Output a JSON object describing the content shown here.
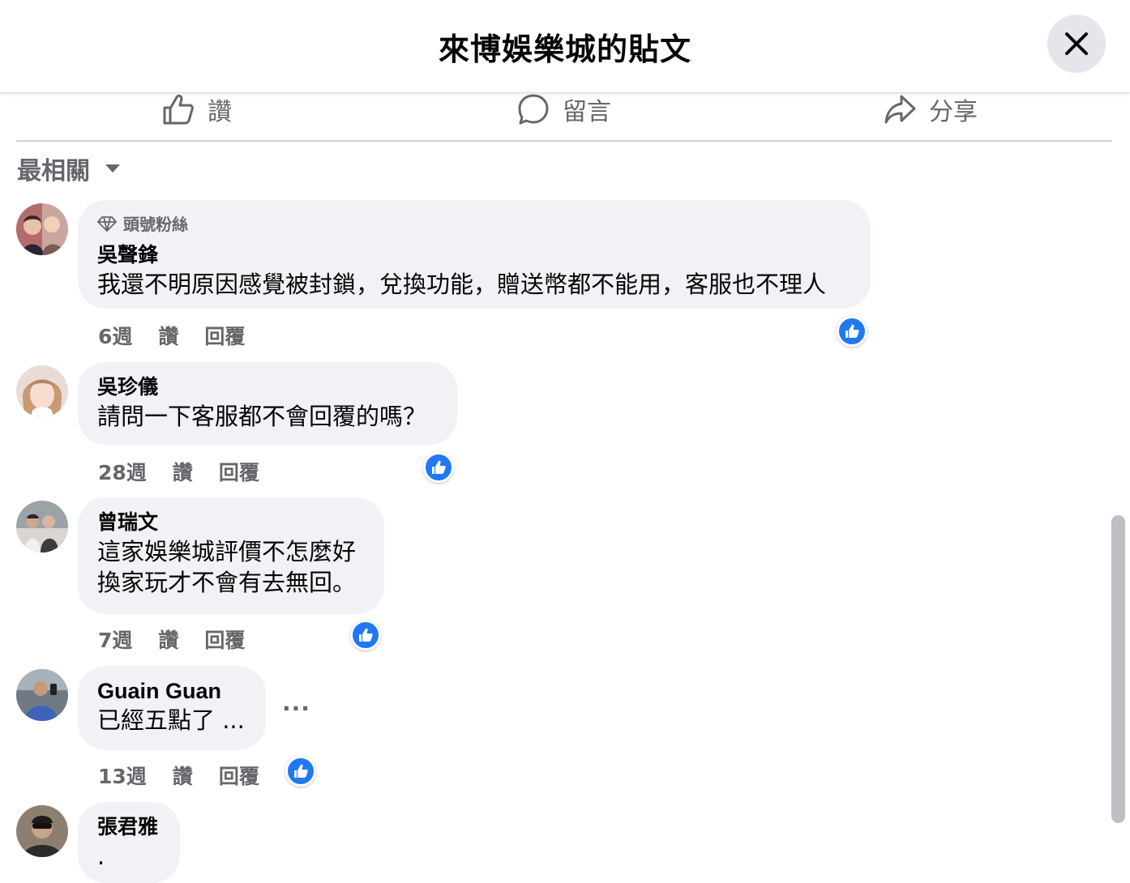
{
  "header": {
    "title": "來博娛樂城的貼文"
  },
  "actions": {
    "like": "讚",
    "comment": "留言",
    "share": "分享"
  },
  "sort": {
    "label": "最相關"
  },
  "comments": [
    {
      "badge": "頭號粉絲",
      "author": "吳聲鋒",
      "text": "我還不明原因感覺被封鎖，兌換功能，贈送幣都不能用，客服也不理人",
      "time": "6週",
      "like": "讚",
      "reply": "回覆"
    },
    {
      "author": "吳珍儀",
      "text": "請問一下客服都不會回覆的嗎？",
      "time": "28週",
      "like": "讚",
      "reply": "回覆"
    },
    {
      "author": "曾瑞文",
      "text": "這家娛樂城評價不怎麼好\n換家玩才不會有去無回。",
      "time": "7週",
      "like": "讚",
      "reply": "回覆"
    },
    {
      "author": "Guain Guan",
      "text": "已經五點了 ...",
      "time": "13週",
      "like": "讚",
      "reply": "回覆",
      "more": "···"
    },
    {
      "author": "張君雅",
      "text": "."
    }
  ],
  "colors": {
    "accent": "#2078f4",
    "bubble": "#f0f2f5",
    "muted": "#65676b"
  }
}
